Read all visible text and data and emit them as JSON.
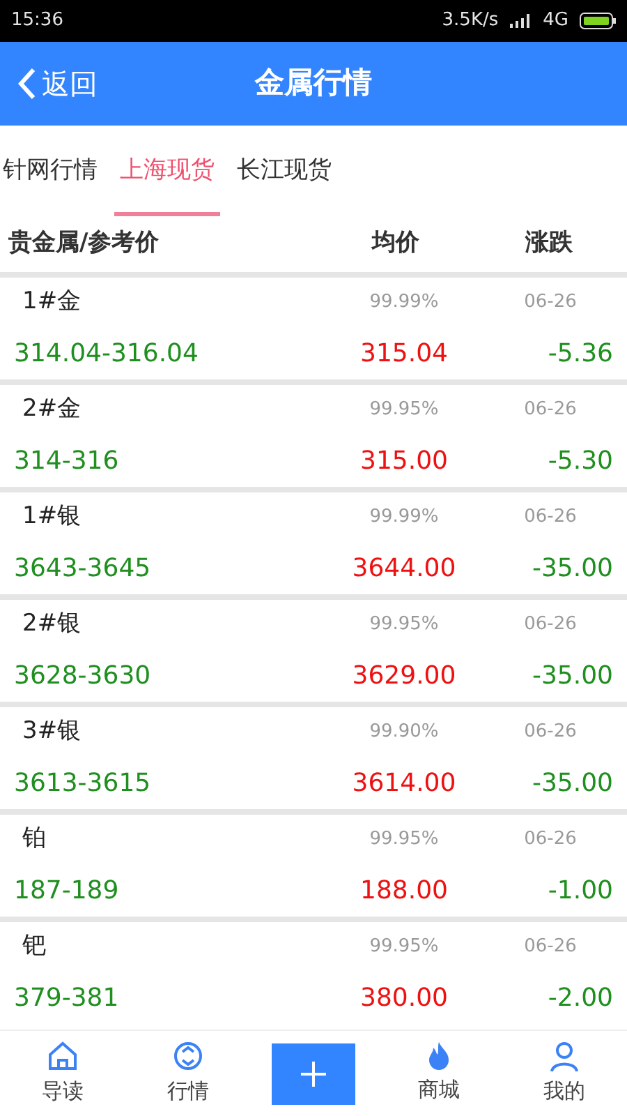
{
  "status_bar": {
    "time": "15:36",
    "speed": "3.5K/s",
    "network": "4G"
  },
  "header": {
    "back": "返回",
    "title": "金属行情"
  },
  "tabs": [
    {
      "label": "针网行情",
      "selected": false
    },
    {
      "label": "上海现货",
      "selected": true
    },
    {
      "label": "长江现货",
      "selected": false
    }
  ],
  "table": {
    "columns": [
      "贵金属/参考价",
      "均价",
      "涨跌"
    ],
    "rows": [
      {
        "name": "1#金",
        "purity": "99.99%",
        "date": "06-26",
        "range": "314.04-316.04",
        "price": "315.04",
        "change": "-5.36"
      },
      {
        "name": "2#金",
        "purity": "99.95%",
        "date": "06-26",
        "range": "314-316",
        "price": "315.00",
        "change": "-5.30"
      },
      {
        "name": "1#银",
        "purity": "99.99%",
        "date": "06-26",
        "range": "3643-3645",
        "price": "3644.00",
        "change": "-35.00"
      },
      {
        "name": "2#银",
        "purity": "99.95%",
        "date": "06-26",
        "range": "3628-3630",
        "price": "3629.00",
        "change": "-35.00"
      },
      {
        "name": "3#银",
        "purity": "99.90%",
        "date": "06-26",
        "range": "3613-3615",
        "price": "3614.00",
        "change": "-35.00"
      },
      {
        "name": "铂",
        "purity": "99.95%",
        "date": "06-26",
        "range": "187-189",
        "price": "188.00",
        "change": "-1.00"
      },
      {
        "name": "钯",
        "purity": "99.95%",
        "date": "06-26",
        "range": "379-381",
        "price": "380.00",
        "change": "-2.00"
      }
    ]
  },
  "nav": [
    {
      "kind": "home",
      "label": "导读"
    },
    {
      "kind": "market",
      "label": "行情"
    },
    {
      "kind": "plus"
    },
    {
      "kind": "fire",
      "label": "商城"
    },
    {
      "kind": "user",
      "label": "我的"
    }
  ]
}
